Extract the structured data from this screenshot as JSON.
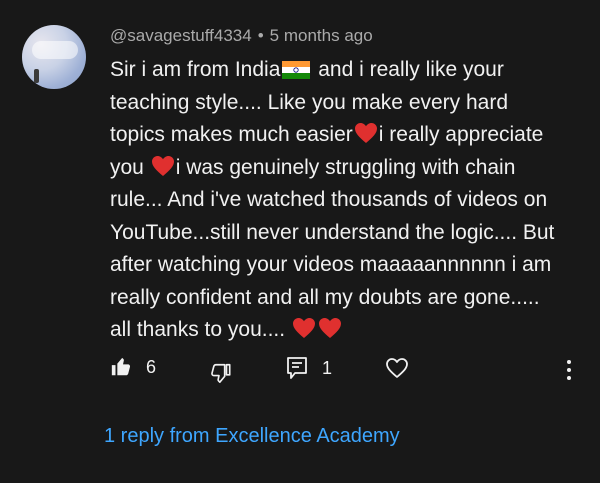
{
  "comment": {
    "author": "@savagestuff4334",
    "separator": "•",
    "timestamp": "5 months ago",
    "lines": {
      "l1a": "Sir i am from India",
      "l1b": " and i really like your",
      "l2": "teaching style.... Like you make every hard",
      "l3": "topics makes much easier",
      "l3b": "i really appreciate",
      "l4a": "you ",
      "l4b": "i was genuinely struggling with chain",
      "l5": "rule... And i've watched thousands of videos on",
      "l6": "YouTube...still never understand the logic.... But",
      "l7": "after watching your videos maaaaannnnnn i am",
      "l8": "really confident and all my doubts are gone.....",
      "l9": "all thanks to you.... "
    }
  },
  "actions": {
    "like_count": "6",
    "reply_count": "1"
  },
  "replies_link": "1 reply from Excellence Academy",
  "colors": {
    "background": "#181818",
    "text": "#f1f1f1",
    "meta": "#aaaaaa",
    "link": "#3ea6ff",
    "heart": "#e0302f"
  },
  "icons": [
    "like-icon",
    "dislike-icon",
    "reply-icon",
    "heart-icon",
    "more-vert-icon",
    "india-flag-icon"
  ]
}
